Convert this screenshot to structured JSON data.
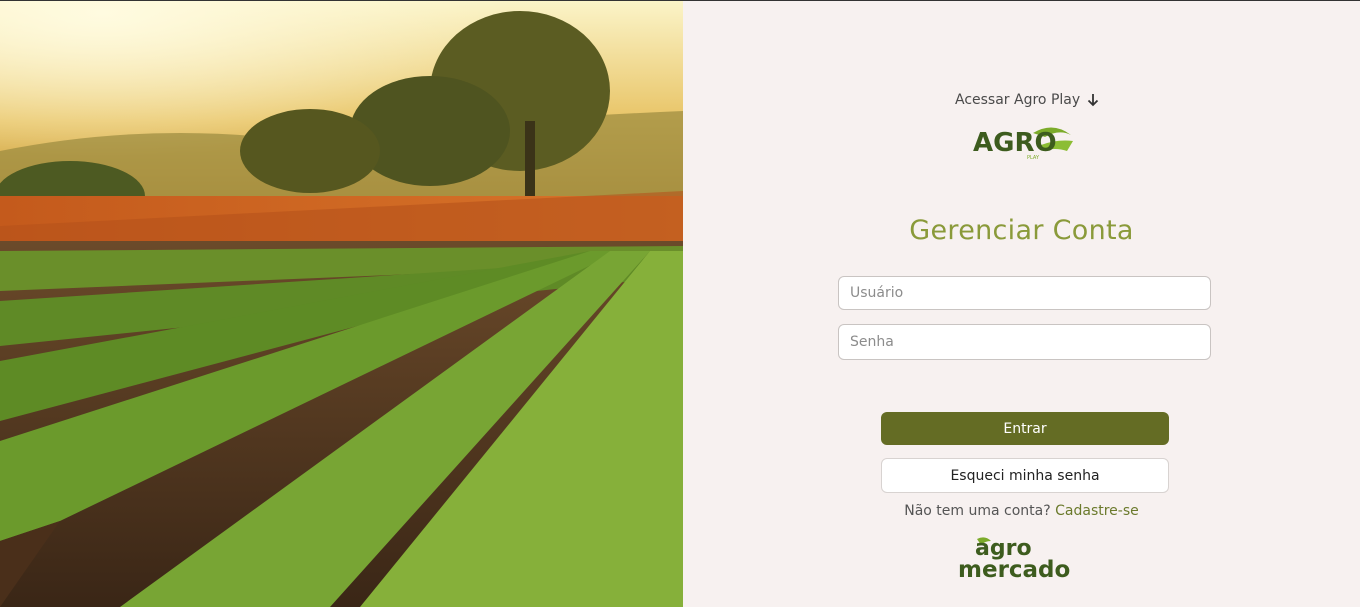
{
  "hero": {
    "image": "farm-field-sunset"
  },
  "access": {
    "label": "Acessar Agro Play",
    "icon": "arrow-down-icon"
  },
  "logo_top": {
    "main": "AGRO",
    "sub": "PLAY"
  },
  "title": "Gerenciar Conta",
  "form": {
    "username_placeholder": "Usuário",
    "username_value": "",
    "password_placeholder": "Senha",
    "password_value": ""
  },
  "buttons": {
    "login": "Entrar",
    "forgot": "Esqueci minha senha"
  },
  "signup": {
    "prompt": "Não tem uma conta?",
    "link": "Cadastre-se"
  },
  "logo_bottom": {
    "line1": "agro",
    "line2": "mercado"
  },
  "colors": {
    "brand_green": "#646c24",
    "title_green": "#8a9a3a",
    "link_green": "#6b7a2c",
    "background": "#f7f1f0"
  }
}
